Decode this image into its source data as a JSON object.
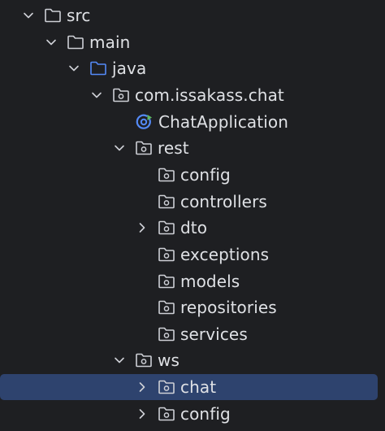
{
  "project_tree": {
    "items": [
      {
        "label": "src",
        "icon": "folder-icon",
        "expanded": true
      },
      {
        "label": "main",
        "icon": "folder-icon",
        "expanded": true
      },
      {
        "label": "java",
        "icon": "source-root-folder-icon",
        "expanded": true
      },
      {
        "label": "com.issakass.chat",
        "icon": "package-icon",
        "expanded": true
      },
      {
        "label": "ChatApplication",
        "icon": "spring-boot-app-icon"
      },
      {
        "label": "rest",
        "icon": "package-icon",
        "expanded": true
      },
      {
        "label": "config",
        "icon": "package-icon"
      },
      {
        "label": "controllers",
        "icon": "package-icon"
      },
      {
        "label": "dto",
        "icon": "package-icon",
        "expanded": false
      },
      {
        "label": "exceptions",
        "icon": "package-icon"
      },
      {
        "label": "models",
        "icon": "package-icon"
      },
      {
        "label": "repositories",
        "icon": "package-icon"
      },
      {
        "label": "services",
        "icon": "package-icon"
      },
      {
        "label": "ws",
        "icon": "package-icon",
        "expanded": true
      },
      {
        "label": "chat",
        "icon": "package-icon",
        "expanded": false,
        "selected": true
      },
      {
        "label": "config",
        "icon": "package-icon",
        "expanded": false
      }
    ]
  },
  "colors": {
    "background": "#1e1f22",
    "text": "#dfe1e5",
    "icon_gray": "#ced0d6",
    "source_root_blue": "#548af7",
    "selection": "#2e436e",
    "spring_green": "#5fb865"
  }
}
